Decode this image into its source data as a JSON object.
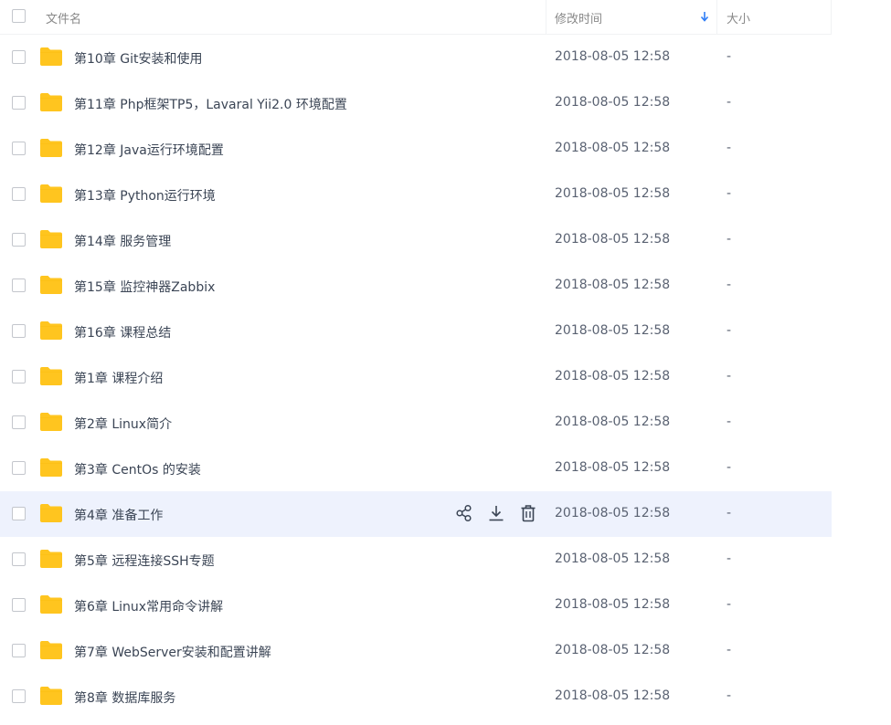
{
  "header": {
    "name_label": "文件名",
    "time_label": "修改时间",
    "size_label": "大小",
    "sort_icon": "arrow-down-icon",
    "sort_color": "#2e7df6"
  },
  "folder_color": "#ffc51f",
  "hover_color": "#eef2fd",
  "rows": [
    {
      "name": "第10章 Git安装和使用",
      "time": "2018-08-05 12:58",
      "size": "-"
    },
    {
      "name": "第11章 Php框架TP5，Lavaral  Yii2.0 环境配置",
      "time": "2018-08-05 12:58",
      "size": "-"
    },
    {
      "name": "第12章 Java运行环境配置",
      "time": "2018-08-05 12:58",
      "size": "-"
    },
    {
      "name": "第13章 Python运行环境",
      "time": "2018-08-05 12:58",
      "size": "-"
    },
    {
      "name": "第14章 服务管理",
      "time": "2018-08-05 12:58",
      "size": "-"
    },
    {
      "name": "第15章 监控神器Zabbix",
      "time": "2018-08-05 12:58",
      "size": "-"
    },
    {
      "name": "第16章 课程总结",
      "time": "2018-08-05 12:58",
      "size": "-"
    },
    {
      "name": "第1章 课程介绍",
      "time": "2018-08-05 12:58",
      "size": "-"
    },
    {
      "name": "第2章 Linux简介",
      "time": "2018-08-05 12:58",
      "size": "-"
    },
    {
      "name": "第3章 CentOs 的安装",
      "time": "2018-08-05 12:58",
      "size": "-"
    },
    {
      "name": "第4章 准备工作",
      "time": "2018-08-05 12:58",
      "size": "-",
      "hover": true,
      "actions": [
        "share-icon",
        "download-icon",
        "delete-icon"
      ]
    },
    {
      "name": "第5章 远程连接SSH专题",
      "time": "2018-08-05 12:58",
      "size": "-"
    },
    {
      "name": "第6章 Linux常用命令讲解",
      "time": "2018-08-05 12:58",
      "size": "-"
    },
    {
      "name": "第7章 WebServer安装和配置讲解",
      "time": "2018-08-05 12:58",
      "size": "-"
    },
    {
      "name": "第8章 数据库服务",
      "time": "2018-08-05 12:58",
      "size": "-"
    }
  ]
}
